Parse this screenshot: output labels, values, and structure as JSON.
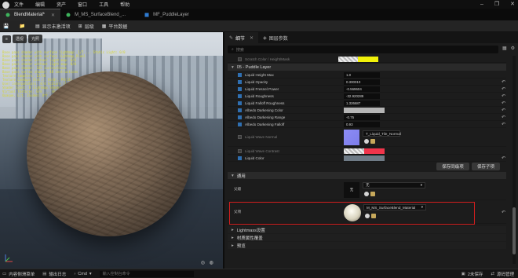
{
  "menubar": {
    "items": [
      "文件",
      "编辑",
      "资产",
      "窗口",
      "工具",
      "帮助"
    ]
  },
  "window_controls": [
    "‒",
    "❐",
    "✕"
  ],
  "tabs": [
    {
      "label": "BlendMaterial*",
      "active": true
    },
    {
      "label": "M_MS_SurfaceBlend_...",
      "active": false
    },
    {
      "label": "MF_PuddleLayer",
      "active": false
    }
  ],
  "toolbar": {
    "save": "",
    "browse": "",
    "show_inactive": "显示未激活项",
    "hierarchy": "层级",
    "platform_stats": "平台数据"
  },
  "viewport": {
    "perspective": "透视",
    "lit": "光照",
    "stats_lines": [
      "Base pass shader with surface lightmap: 1/7 ... Static Light: 0/0",
      "Base pass shader with surface lightmap_Pixel",
      "Base pass shader without light map: 0/0",
      "Base pass shader without light map: 0/0",
      "Base pass shader: 165 instructions",
      "Base pass vertex shader: 48 instructions",
      "Texture samplers: 11/16",
      "Texture Lookups (Est.): VS(0), PS(14)",
      "User interpolators: 4/4 Scalars (1/4 Vectors) (TexCoords: 4, Custom: 0)",
      "Shader Count: 8 Lightmap Shaders: 0 ... 1 InstanceFactor",
      "Virtual Textures: 0/8 ... ShaderModel: 5 ... MaterialStats",
      "Opaque, Lit, 2Sided: Off, 4 Dirs:2 ... Sample Density"
    ]
  },
  "details": {
    "tab_details": "细节",
    "tab_layer_params": "图层参数",
    "search_placeholder": "搜索",
    "rows_top": [
      {
        "name": "Scratch Color / Height/Mask",
        "dim": true,
        "checked": false
      }
    ],
    "section_puddle": "05 - Puddle Layer",
    "puddle_rows": [
      {
        "name": "Liquid Height Max",
        "value": "1.0",
        "checked": true
      },
      {
        "name": "Liquid Opacity",
        "value": "0.300010",
        "checked": true
      },
      {
        "name": "Liquid Fresnel Power",
        "value": "-0.569604",
        "checked": true
      },
      {
        "name": "Liquid Roughness",
        "value": "-32.920289",
        "checked": true
      },
      {
        "name": "Liquid Falloff Roughness",
        "value": "1.326687",
        "checked": true
      },
      {
        "name": "Albedo Darkening Color",
        "value": "",
        "checked": true
      },
      {
        "name": "Albedo Darkening Range",
        "value": "-0.75",
        "checked": true
      },
      {
        "name": "Albedo Darkening Falloff",
        "value": "0.93",
        "checked": true
      }
    ],
    "liquid_wave_normal": "Liquid Wave Normal",
    "liquid_wave_normal_asset": "T_Liquid_Tile_Normal",
    "liquid_wave_contrast": "Liquid Wave Contrast",
    "liquid_color": "Liquid Color",
    "btn_save_sibling": "保存同级项",
    "btn_save_child": "保存子项",
    "section_general": "通用",
    "parent_label": "父级",
    "parent_none": "无",
    "parent_value": "无",
    "material_label": "父项",
    "material_value": "M_MS_SurfaceBlend_Material",
    "lightmass_settings": "Lightmass设置",
    "material_property_overrides": "材质属性覆盖",
    "preview": "预览"
  },
  "statusbar": {
    "content_drawer": "内容侧滑菜单",
    "output_log": "输出日志",
    "cmd": "Cmd",
    "cmd_placeholder": "输入控制台命令",
    "unsaved": "2未保存",
    "source_control": "源码管理"
  },
  "colors": {
    "accent": "#2f6fb1",
    "highlight_box": "#d11e1e",
    "swatch_yellow": "#f2f20a",
    "swatch_red": "#f0354b",
    "swatch_gray": "#b5b5b5",
    "swatch_liquid": "#6f7b86"
  }
}
